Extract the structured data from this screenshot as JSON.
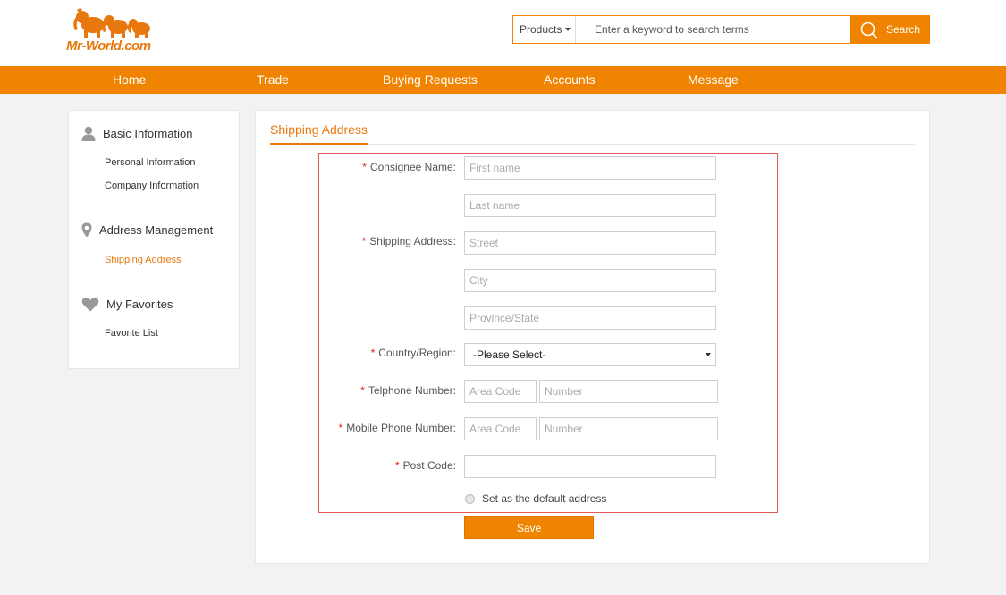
{
  "brand": {
    "logo_text": "Mr-World.com",
    "accent": "#f08300"
  },
  "search": {
    "category": "Products",
    "placeholder": "Enter a keyword to search terms",
    "button_label": "Search"
  },
  "nav": {
    "items": [
      {
        "label": "Home"
      },
      {
        "label": "Trade"
      },
      {
        "label": "Buying Requests"
      },
      {
        "label": "Accounts"
      },
      {
        "label": "Message"
      }
    ]
  },
  "sidebar": {
    "sections": [
      {
        "title": "Basic Information",
        "icon": "user-icon",
        "items": [
          {
            "label": "Personal Information"
          },
          {
            "label": "Company Information"
          }
        ]
      },
      {
        "title": "Address Management",
        "icon": "map-pin-icon",
        "items": [
          {
            "label": "Shipping Address",
            "active": true
          }
        ]
      },
      {
        "title": "My Favorites",
        "icon": "heart-icon",
        "items": [
          {
            "label": "Favorite List"
          }
        ]
      }
    ]
  },
  "main": {
    "tab": "Shipping Address",
    "form": {
      "consignee_label": "Consignee Name:",
      "first_name_placeholder": "First name",
      "last_name_placeholder": "Last name",
      "shipping_label": "Shipping Address:",
      "street_placeholder": "Street",
      "city_placeholder": "City",
      "province_placeholder": "Province/State",
      "country_label": "Country/Region:",
      "country_value": "-Please Select-",
      "telephone_label": "Telphone Number:",
      "mobile_label": "Mobile Phone Number:",
      "area_code_placeholder": "Area Code",
      "number_placeholder": "Number",
      "postcode_label": "Post Code:",
      "postcode_placeholder": "",
      "default_address_label": "Set as the default address",
      "required_marker": "*",
      "save_label": "Save"
    }
  }
}
